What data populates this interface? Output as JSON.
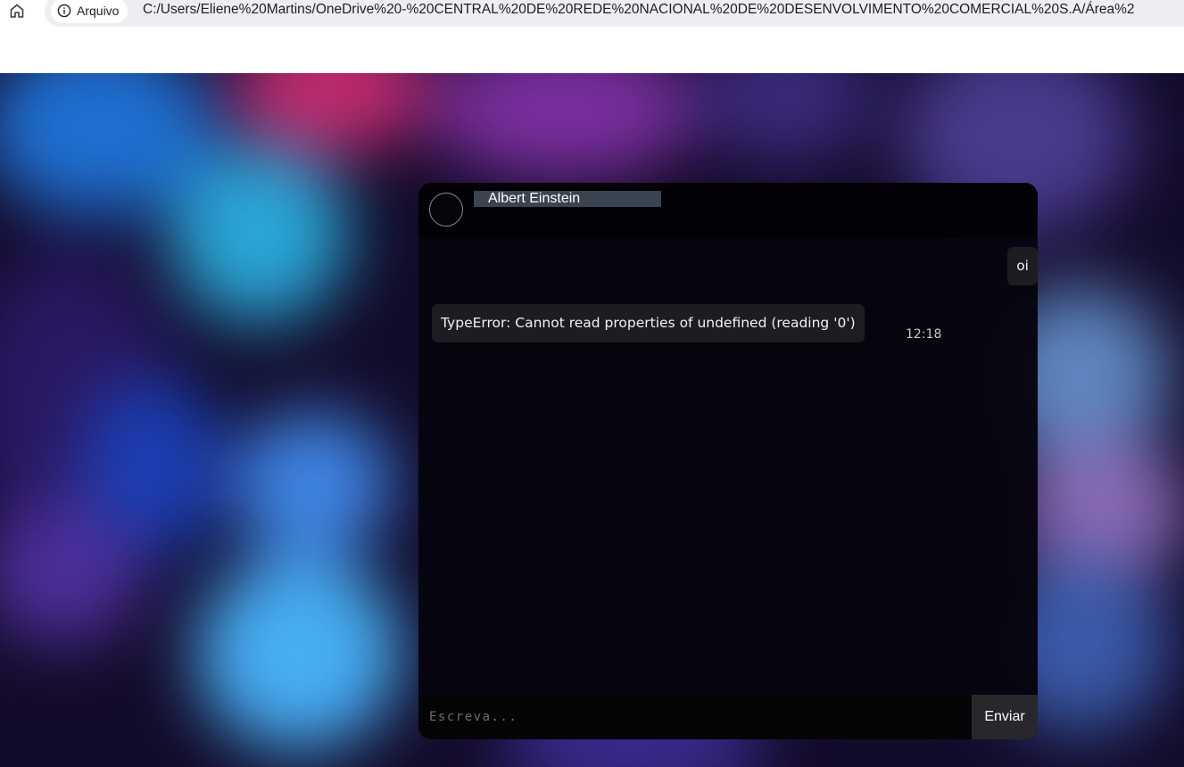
{
  "browser": {
    "home_icon": "home-icon",
    "site_info_icon": "info-icon",
    "site_label": "Arquivo",
    "url": "C:/Users/Eliene%20Martins/OneDrive%20-%20CENTRAL%20DE%20REDE%20NACIONAL%20DE%20DESENVOLVIMENTO%20COMERCIAL%20S.A/Área%2"
  },
  "chat": {
    "contact_name": "Albert Einstein",
    "messages": [
      {
        "direction": "outgoing",
        "text": "oi"
      },
      {
        "direction": "incoming",
        "text": "TypeError: Cannot read properties of undefined (reading '0')",
        "time": "12:18"
      }
    ],
    "input_placeholder": "Escreva...",
    "input_value": "",
    "send_label": "Enviar"
  }
}
